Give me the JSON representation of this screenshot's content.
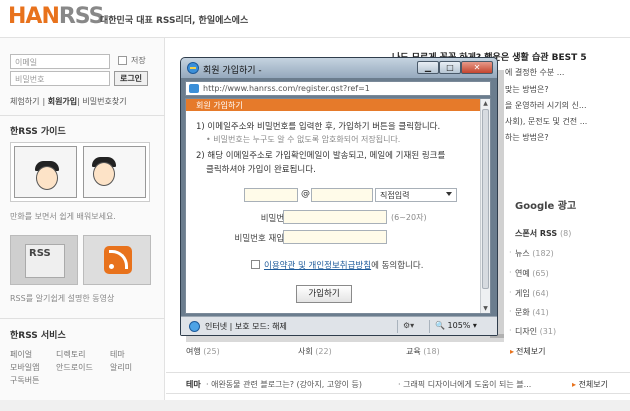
{
  "site": {
    "logo_han": "HAN",
    "logo_rss": "RSS",
    "tagline": "대한민국 대표 RSS리더, 한일에스에스"
  },
  "login": {
    "email_placeholder": "이메일",
    "password_placeholder": "비밀번호",
    "save_label": "저장",
    "login_button": "로그인",
    "links": [
      "체험하기",
      "회원가입",
      "비밀번호찾기"
    ]
  },
  "guide": {
    "title": "한RSS 가이드",
    "comic_caption": "만화를 보면서 쉽게 배워보세요.",
    "video_caption": "RSS를 알기쉽게 설명한 동영상",
    "thumb_text": "RSS"
  },
  "services": {
    "title": "한RSS 서비스",
    "items": [
      "페이얼",
      "디렉토리",
      "테마",
      "모바일앱",
      "안드로이드",
      "알리미",
      "구독버튼"
    ]
  },
  "main": {
    "top_news_title": "나도 모르게 꼭꼭 하게? 행운은 생활 습관 BEST 5",
    "news_lines": [
      "에 결정한 수분 ...",
      "맞는 방법은?",
      "을 운영하러 시기의 신...",
      "사회), 문전도 및 건전 ...",
      "하는 방법은?"
    ],
    "google_ad": "Google 광고",
    "category_header": "스폰서 RSS",
    "category_header_count": "(8)",
    "categories": [
      {
        "name": "뉴스",
        "count": "(182)"
      },
      {
        "name": "연예",
        "count": "(65)"
      },
      {
        "name": "게임",
        "count": "(64)"
      },
      {
        "name": "문화",
        "count": "(41)"
      },
      {
        "name": "디자인",
        "count": "(31)"
      }
    ],
    "all_view": "전체보기",
    "bottom_cats": [
      {
        "name": "여행",
        "count": "(25)"
      },
      {
        "name": "사회",
        "count": "(22)"
      },
      {
        "name": "교육",
        "count": "(18)"
      }
    ],
    "theme_label": "테마",
    "theme_text1": "· 애완동물 관련 블로그는? (강아지, 고양이 등)",
    "theme_text2": "· 그래픽 디자이너에게 도움이 되는 블...",
    "theme_all": "전체보기"
  },
  "popup": {
    "window_title": "회원 가입하기 -",
    "url": "http://www.hanrss.com/register.qst?ref=1",
    "section_title": "회원 가입하기",
    "instruction_1": "1) 이메일주소와 비밀번호를 입력한 후, 가입하기 버튼을 클릭합니다.",
    "instruction_1_sub": "• 비밀번호는 누구도 알 수 없도록 암호화되어 저장됩니다.",
    "instruction_2": "2) 해당 이메일주소로 가입확인메일이 발송되고, 메일에 기재된 링크를",
    "instruction_2b": "클릭하셔야 가입이 완료됩니다.",
    "email_label": "이메일",
    "at_sign": "@",
    "domain_select": "직접입력",
    "password_label": "비밀번호",
    "password_hint": "(6~20자)",
    "password_confirm_label": "비밀번호 재입력",
    "agree_text_pre": "이용약관 및 ",
    "agree_link": "개인정보취급방침",
    "agree_text_post": "에 동의합니다.",
    "join_button": "가입하기",
    "status_text": "인터넷 | 보호 모드: 해제",
    "zoom": "105%"
  },
  "colors": {
    "brand_orange": "#e8721c",
    "popup_header": "#e67a2a",
    "link_blue": "#1d5a9a"
  }
}
